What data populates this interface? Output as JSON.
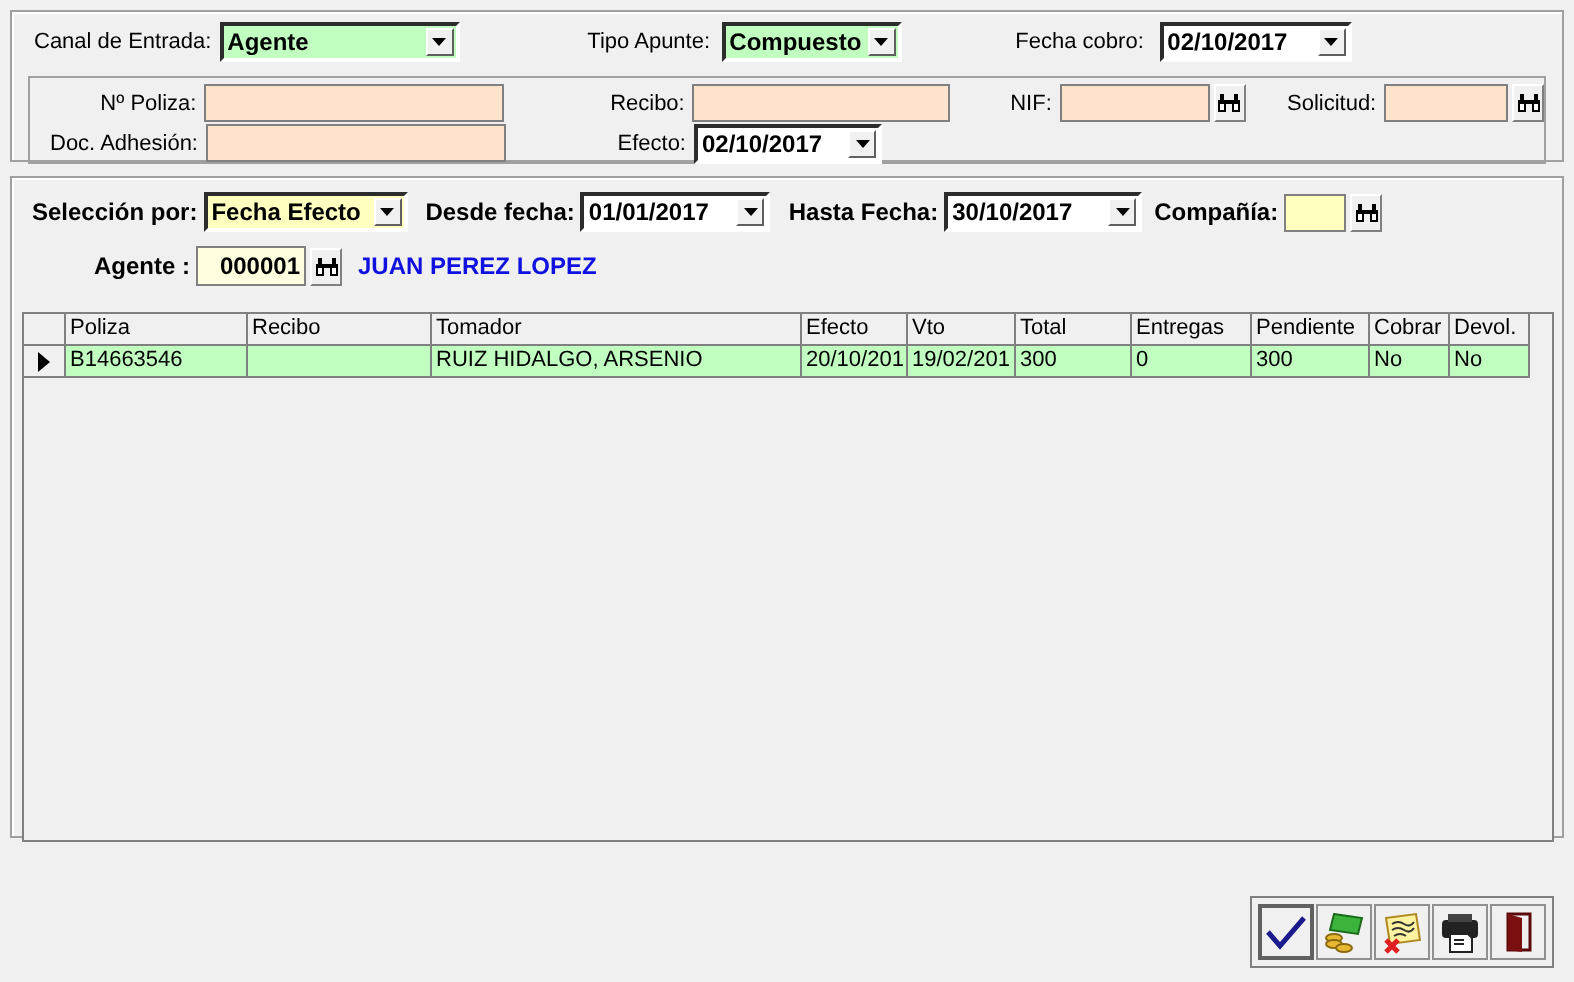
{
  "header": {
    "canal": {
      "label": "Canal de Entrada:",
      "value": "Agente"
    },
    "tipo_apunte": {
      "label": "Tipo Apunte:",
      "value": "Compuesto"
    },
    "fecha_cobro": {
      "label": "Fecha cobro:",
      "value": "02/10/2017"
    }
  },
  "search": {
    "poliza": {
      "label": "Nº Poliza:"
    },
    "recibo": {
      "label": "Recibo:"
    },
    "nif": {
      "label": "NIF:"
    },
    "solicitud": {
      "label": "Solicitud:"
    },
    "doc_adhesion": {
      "label": "Doc. Adhesión:"
    },
    "efecto": {
      "label": "Efecto:",
      "value": "02/10/2017"
    }
  },
  "filters": {
    "seleccion": {
      "label": "Selección por:",
      "value": "Fecha Efecto"
    },
    "desde": {
      "label": "Desde fecha:",
      "value": "01/01/2017"
    },
    "hasta": {
      "label": "Hasta Fecha:",
      "value": "30/10/2017"
    },
    "compania": {
      "label": "Compañía:"
    },
    "agente": {
      "label": "Agente :",
      "code": "000001",
      "name": "JUAN PEREZ LOPEZ"
    }
  },
  "table": {
    "columns": [
      "Poliza",
      "Recibo",
      "Tomador",
      "Efecto",
      "Vto",
      "Total",
      "Entregas",
      "Pendiente",
      "Cobrar",
      "Devol."
    ],
    "rows": [
      {
        "selected": true,
        "cells": [
          "B14663546",
          "",
          "RUIZ HIDALGO, ARSENIO",
          "20/10/201",
          "19/02/201",
          "300",
          "0",
          "300",
          "No",
          "No"
        ]
      }
    ]
  },
  "actions": [
    {
      "kind": "accept",
      "focused": true
    },
    {
      "kind": "money",
      "focused": false
    },
    {
      "kind": "cancel-note",
      "focused": false
    },
    {
      "kind": "print",
      "focused": false
    },
    {
      "kind": "exit",
      "focused": false
    }
  ]
}
